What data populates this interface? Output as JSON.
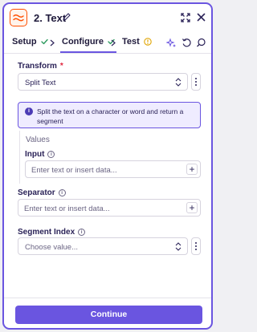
{
  "header": {
    "title": "2. Text",
    "icons": [
      "text-formatter-app-icon",
      "pencil-icon",
      "expand-icon",
      "close-icon"
    ]
  },
  "tabs": [
    {
      "label": "Setup",
      "status": "complete"
    },
    {
      "label": "Configure",
      "status": "complete",
      "active": true
    },
    {
      "label": "Test",
      "status": "warning"
    }
  ],
  "toolbar": {
    "icons": [
      "ai-sparkle-icon",
      "refresh-icon",
      "search-icon"
    ]
  },
  "transform": {
    "label": "Transform",
    "required_mark": "*",
    "value": "Split Text"
  },
  "info": {
    "text": "Split the text on a character or word and return a segment"
  },
  "values": {
    "title": "Values",
    "input_label": "Input",
    "input_placeholder": "Enter text or insert data..."
  },
  "separator": {
    "label": "Separator",
    "placeholder": "Enter text or insert data..."
  },
  "segment_index": {
    "label": "Segment Index",
    "placeholder": "Choose value..."
  },
  "footer": {
    "continue_label": "Continue"
  },
  "colors": {
    "accent": "#6a55e0",
    "app_icon": "#ff4f00",
    "success": "#2e9b5f",
    "warning": "#e0a400",
    "required": "#e0243c"
  }
}
